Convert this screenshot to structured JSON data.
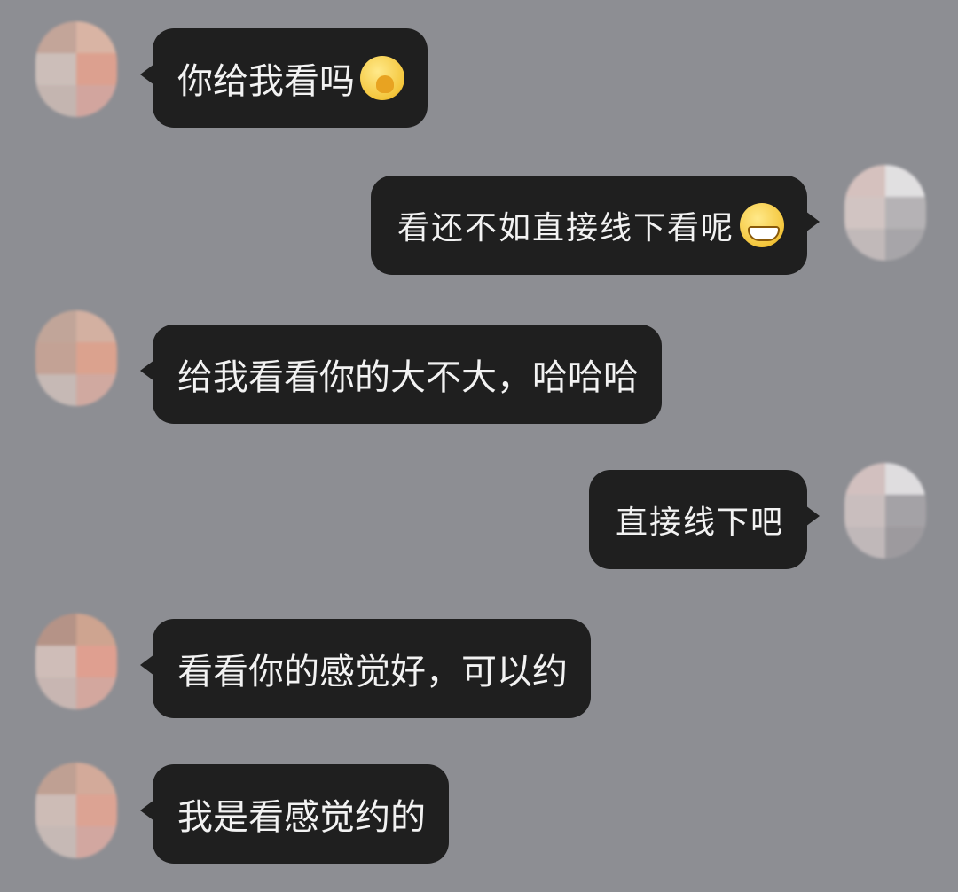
{
  "messages": [
    {
      "side": "left",
      "text": "你给我看吗",
      "emoji": "shy-face-emoji"
    },
    {
      "side": "right",
      "text": "看还不如直接线下看呢",
      "emoji": "grinning-face-emoji"
    },
    {
      "side": "left",
      "text": "给我看看你的大不大，哈哈哈"
    },
    {
      "side": "right",
      "text": "直接线下吧"
    },
    {
      "side": "left",
      "text": "看看你的感觉好，可以约"
    },
    {
      "side": "left",
      "text": "我是看感觉约的"
    }
  ],
  "colors": {
    "background": "#8d8e93",
    "bubble": "#1f1f1f",
    "text": "#f2f2f2"
  }
}
